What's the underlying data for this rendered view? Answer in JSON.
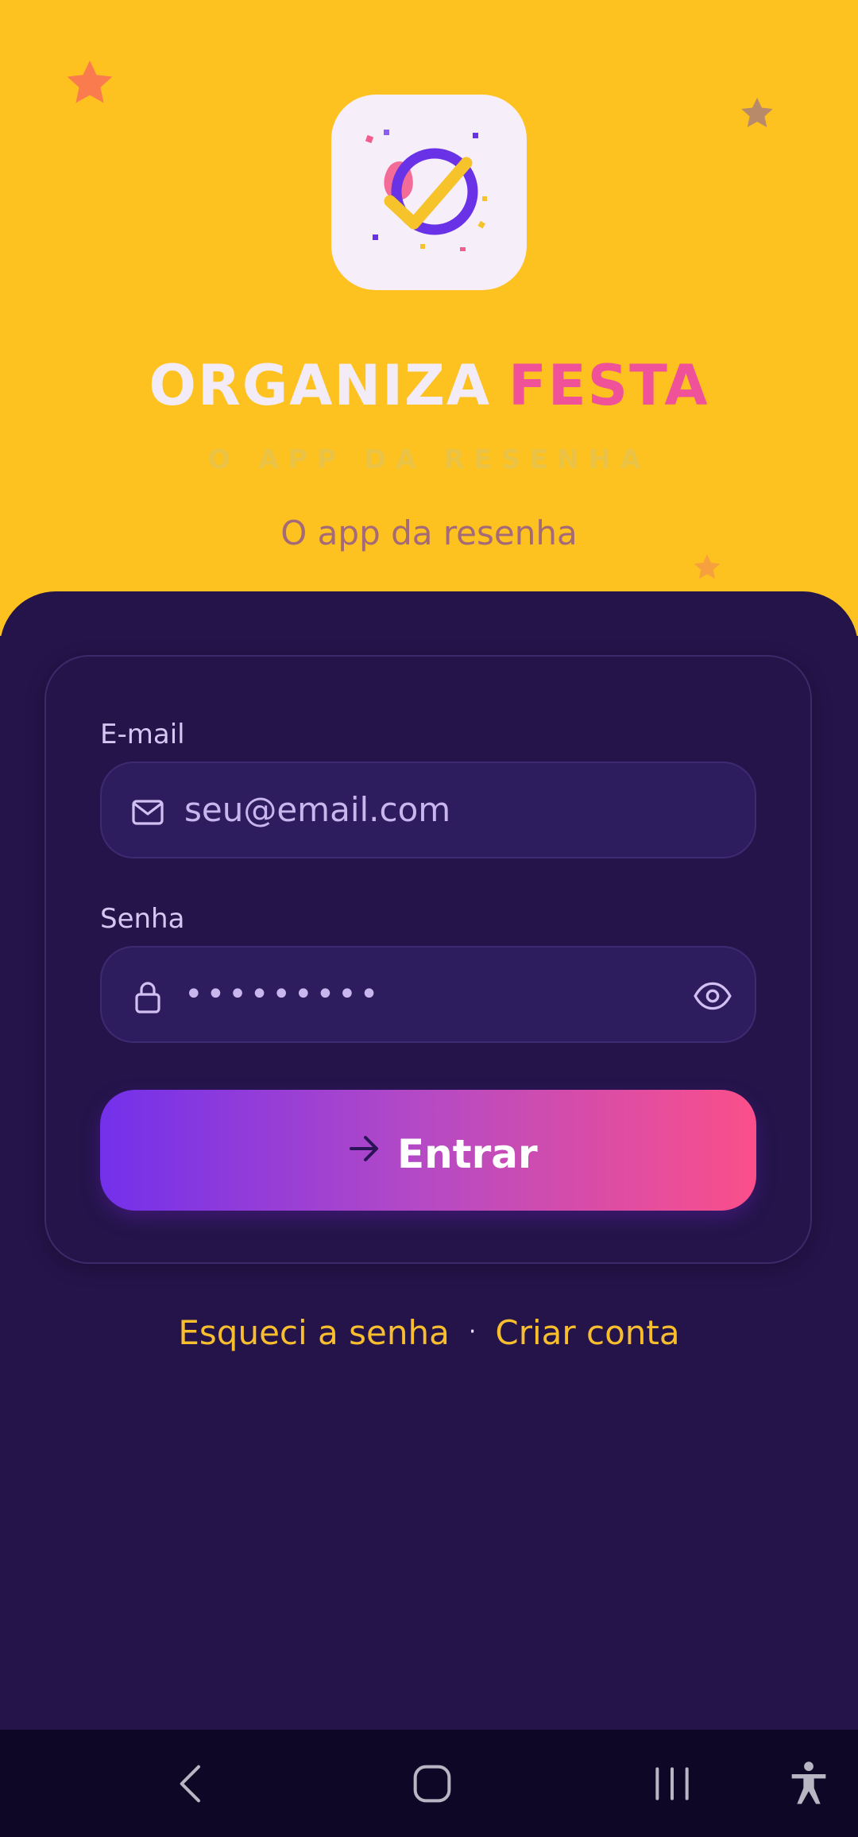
{
  "app": {
    "brand_word1": "ORGANIZA",
    "brand_word2": "FESTA",
    "tagline_caps": "O APP DA RESENHA",
    "tagline": "O app da resenha"
  },
  "form": {
    "email_label": "E-mail",
    "email_placeholder": "seu@email.com",
    "password_label": "Senha",
    "password_value": "•••••••••",
    "submit_label": "Entrar"
  },
  "links": {
    "forgot": "Esqueci a senha",
    "separator": "·",
    "create": "Criar conta"
  },
  "icons": {
    "logo": "party-checkmark-logo",
    "email": "mail-icon",
    "password": "lock-icon",
    "toggle": "eye-icon",
    "submit": "arrow-right-icon",
    "nav": [
      "back-icon",
      "home-icon",
      "recents-icon",
      "accessibility-icon"
    ]
  },
  "colors": {
    "hero_bg": "#FDC21F",
    "sheet_bg": "#24144A",
    "brand_accent": "#F0529A",
    "link": "#F9BE2E",
    "button_gradient": [
      "#7330EB",
      "#FB4F8A"
    ]
  }
}
